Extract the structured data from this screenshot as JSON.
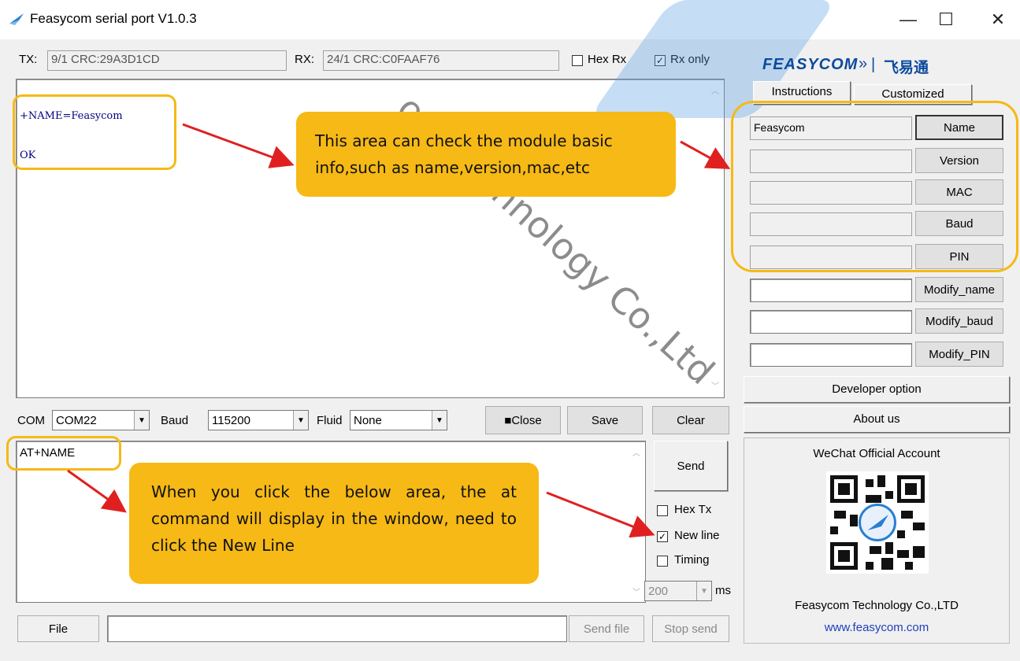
{
  "window": {
    "title": "Feasycom serial port V1.0.3"
  },
  "status": {
    "tx_label": "TX:",
    "tx_value": "9/1 CRC:29A3D1CD",
    "rx_label": "RX:",
    "rx_value": "24/1 CRC:C0FAAF76",
    "hex_rx_label": "Hex Rx",
    "hex_rx_checked": false,
    "rx_only_label": "Rx only",
    "rx_only_checked": true
  },
  "receive": {
    "lines": [
      "+NAME=Feasycom",
      "",
      "OK"
    ]
  },
  "watermark": "om Technology Co.,Ltd",
  "brand": {
    "logo": "FEASYCOM",
    "sep": "|",
    "chinese": "飞易通"
  },
  "tabs": {
    "instructions": "Instructions",
    "customized": "Customized"
  },
  "info_rows": [
    {
      "value": "Feasycom",
      "button": "Name"
    },
    {
      "value": "",
      "button": "Version"
    },
    {
      "value": "",
      "button": "MAC"
    },
    {
      "value": "",
      "button": "Baud"
    },
    {
      "value": "",
      "button": "PIN"
    }
  ],
  "modify_rows": [
    {
      "value": "",
      "button": "Modify_name"
    },
    {
      "value": "",
      "button": "Modify_baud"
    },
    {
      "value": "",
      "button": "Modify_PIN"
    }
  ],
  "side_buttons": {
    "developer": "Developer option",
    "about": "About us"
  },
  "wechat": {
    "title": "WeChat Official Account",
    "company": "Feasycom Technology Co.,LTD",
    "website": "www.feasycom.com"
  },
  "port": {
    "com_label": "COM",
    "com_value": "COM22",
    "baud_label": "Baud",
    "baud_value": "115200",
    "fluid_label": "Fluid",
    "fluid_value": "None",
    "close_label": "■Close",
    "save_label": "Save",
    "clear_label": "Clear"
  },
  "send": {
    "input_value": "AT+NAME",
    "send_label": "Send",
    "hex_tx_label": "Hex Tx",
    "hex_tx_checked": false,
    "new_line_label": "New line",
    "new_line_checked": true,
    "timing_label": "Timing",
    "timing_checked": false,
    "interval_value": "200",
    "interval_unit": "ms"
  },
  "file_bar": {
    "file_label": "File",
    "path_value": "",
    "send_file_label": "Send file",
    "stop_send_label": "Stop send"
  },
  "callouts": {
    "top": "This area can check the module basic info,such as name,version,mac,etc",
    "bottom": "When you click the below area, the at command will display in the window, need to click the New Line"
  },
  "colors": {
    "callout": "#f6b915",
    "arrow": "#e02020",
    "receive_text": "#000080"
  }
}
